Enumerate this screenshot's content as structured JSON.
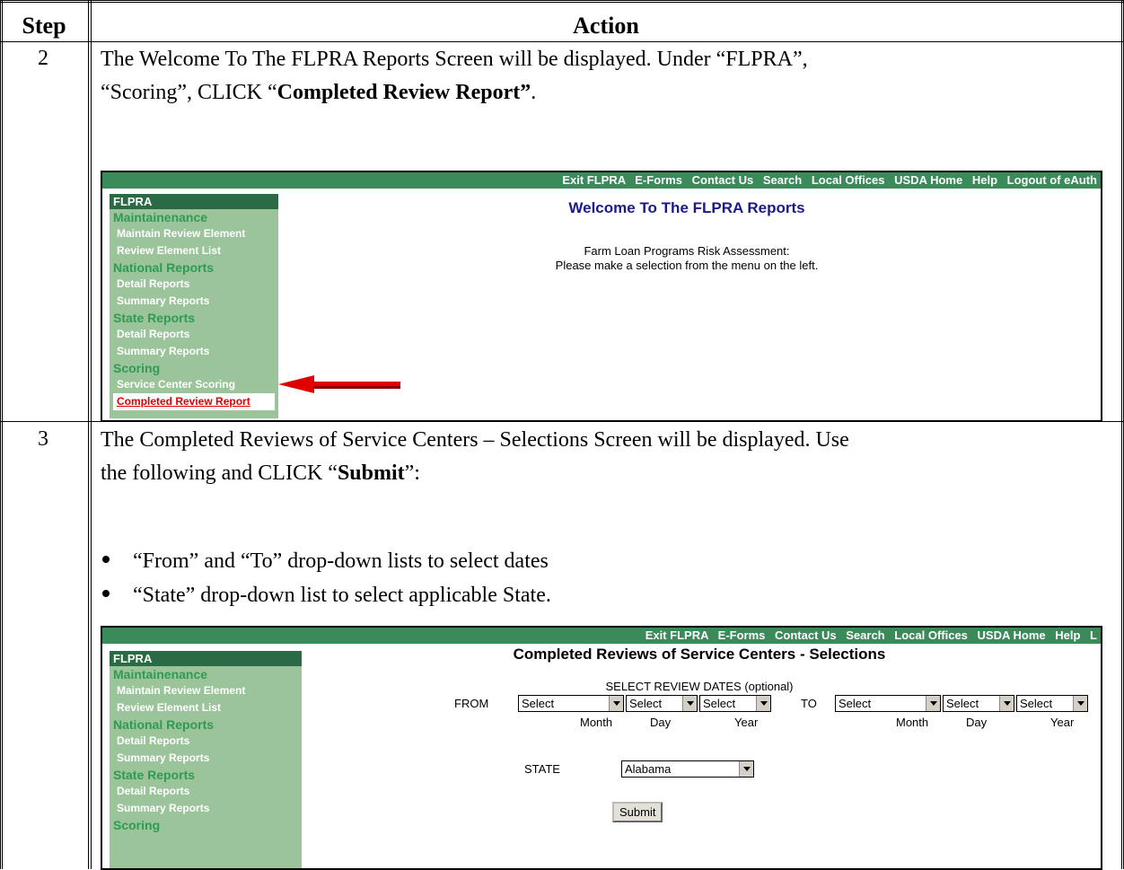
{
  "table": {
    "header_step": "Step",
    "header_action": "Action"
  },
  "step2": {
    "number": "2",
    "line1": "The Welcome To The FLPRA Reports Screen will be displayed.  Under “FLPRA”,",
    "line2_a": "“Scoring”, CLICK “",
    "line2_bold": "Completed Review Report”",
    "line2_b": "."
  },
  "step3": {
    "number": "3",
    "line1": "The Completed Reviews of Service Centers – Selections Screen will be displayed.  Use",
    "line2_a": "the following and CLICK “",
    "line2_bold": "Submit",
    "line2_b": "”:",
    "bullet1": "“From” and “To” drop-down lists to select dates",
    "bullet2": "“State” drop-down list to select applicable State."
  },
  "shot1": {
    "topnav": [
      "Exit FLPRA",
      "E-Forms",
      "Contact Us",
      "Search",
      "Local Offices",
      "USDA Home",
      "Help",
      "Logout of eAuth"
    ],
    "sidebar_title": "FLPRA",
    "sections": {
      "maint": "Maintainenance",
      "national": "National Reports",
      "state": "State Reports",
      "scoring": "Scoring"
    },
    "items": {
      "maintain_review_element": "Maintain Review Element",
      "review_element_list": "Review Element List",
      "nat_detail": "Detail Reports",
      "nat_summary": "Summary Reports",
      "st_detail": "Detail Reports",
      "st_summary": "Summary Reports",
      "service_center_scoring": "Service Center Scoring",
      "completed_review_report": "Completed Review Report"
    },
    "welcome": "Welcome To The FLPRA Reports",
    "body1": "Farm Loan Programs Risk Assessment:",
    "body2": "Please make a selection from the menu on the left."
  },
  "shot2": {
    "topnav": [
      "Exit FLPRA",
      "E-Forms",
      "Contact Us",
      "Search",
      "Local Offices",
      "USDA Home",
      "Help",
      "L"
    ],
    "sidebar_title": "FLPRA",
    "sections": {
      "maint": "Maintainenance",
      "national": "National Reports",
      "state": "State Reports",
      "scoring": "Scoring"
    },
    "items": {
      "maintain_review_element": "Maintain Review Element",
      "review_element_list": "Review Element List",
      "nat_detail": "Detail Reports",
      "nat_summary": "Summary Reports",
      "st_detail": "Detail Reports",
      "st_summary": "Summary Reports"
    },
    "title": "Completed Reviews of Service Centers - Selections",
    "select_dates": "SELECT REVIEW DATES (optional)",
    "from": "FROM",
    "to": "TO",
    "select": "Select",
    "month": "Month",
    "day": "Day",
    "year": "Year",
    "state_label": "STATE",
    "state_value": "Alabama",
    "submit": "Submit"
  },
  "colors": {
    "topbar": "#3a8a5a",
    "sidebar": "#9bc49b",
    "sidebar_title": "#2a6a45",
    "section_heading": "#2f9a58",
    "welcome_title": "#1a1a8a",
    "highlight_arrow": "#e00000"
  }
}
